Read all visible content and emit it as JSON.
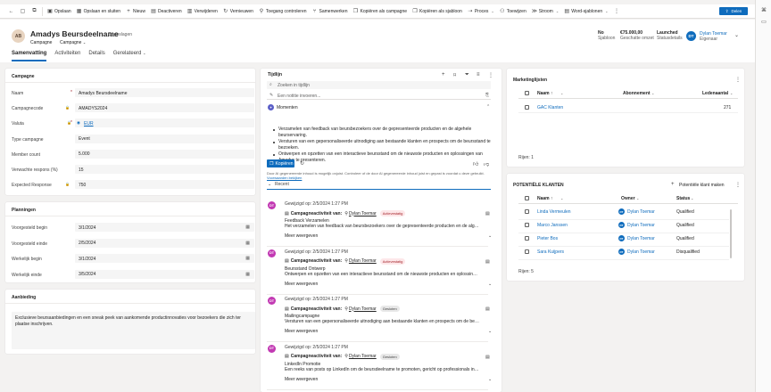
{
  "command_bar": {
    "nav": [
      {
        "name": "back-icon",
        "glyph": "←"
      },
      {
        "name": "page-icon",
        "glyph": "▢"
      },
      {
        "name": "popout-icon",
        "glyph": "⧉"
      }
    ],
    "commands": [
      {
        "name": "save-button",
        "icon": "save-icon",
        "glyph": "▣",
        "label": "Opslaan"
      },
      {
        "name": "save-close-button",
        "icon": "save-close-icon",
        "glyph": "▦",
        "label": "Opslaan en sluiten"
      },
      {
        "name": "new-button",
        "icon": "plus-icon",
        "glyph": "+",
        "label": "Nieuw"
      },
      {
        "name": "deactivate-button",
        "icon": "deactivate-icon",
        "glyph": "▤",
        "label": "Deactiveren"
      },
      {
        "name": "delete-button",
        "icon": "trash-icon",
        "glyph": "▥",
        "label": "Verwijderen"
      },
      {
        "name": "refresh-button",
        "icon": "refresh-icon",
        "glyph": "↻",
        "label": "Vernieuwen"
      },
      {
        "name": "check-access-button",
        "icon": "key-icon",
        "glyph": "⚲",
        "label": "Toegang controleren"
      },
      {
        "name": "merge-button",
        "icon": "merge-icon",
        "glyph": "⑂",
        "label": "Samenwerken"
      },
      {
        "name": "copy-as-campaign-button",
        "icon": "copy-icon",
        "glyph": "❐",
        "label": "Kopiëren als campagne"
      },
      {
        "name": "copy-as-template-button",
        "icon": "copy-template-icon",
        "glyph": "❐",
        "label": "Kopiëren als sjabloon"
      },
      {
        "name": "process-button",
        "icon": "process-icon",
        "glyph": "⇢",
        "label": "Proces",
        "chevron": true
      },
      {
        "name": "assign-button",
        "icon": "assign-icon",
        "glyph": "⚇",
        "label": "Toewijzen"
      },
      {
        "name": "flow-button",
        "icon": "flow-icon",
        "glyph": "≫",
        "label": "Stroom",
        "chevron": true
      },
      {
        "name": "word-templates-button",
        "icon": "word-icon",
        "glyph": "▤",
        "label": "Word-sjablonen",
        "chevron": true
      }
    ],
    "more_glyph": "⋮",
    "share_label": "Delen"
  },
  "header": {
    "initials": "AB",
    "title": "Amadys Beursdeelname",
    "saved": "- Opgeslagen",
    "entity": "Campagne",
    "form": "Campagne",
    "fields": [
      {
        "value": "No",
        "label": "Sjabloon"
      },
      {
        "value": "€75.000,00",
        "label": "Geschatte omzet"
      },
      {
        "value": "Launched",
        "label": "Statusdetails"
      }
    ],
    "owner_initials": "DT",
    "owner_name": "Dylan Toemar",
    "owner_label": "Eigenaar"
  },
  "tabs": [
    "Samenvatting",
    "Activiteiten",
    "Details",
    "Gerelateerd"
  ],
  "campaign": {
    "title": "Campagne",
    "fields": [
      {
        "label": "Naam",
        "value": "Amadys Beursdeelname",
        "req": "*"
      },
      {
        "label": "Campagnecode",
        "value": "AMADYS2024",
        "lock": "🔒"
      },
      {
        "label": "Valuta",
        "value": "EUR",
        "req": "*",
        "lock": "🔒",
        "link": true
      },
      {
        "label": "Type campagne",
        "value": "Event"
      },
      {
        "label": "Member count",
        "value": "5.000"
      },
      {
        "label": "Verwachte respons (%)",
        "value": "15"
      },
      {
        "label": "Expected Response",
        "value": "750",
        "lock": "🔒"
      }
    ]
  },
  "planning": {
    "title": "Planningen",
    "fields": [
      {
        "label": "Voorgesteld begin",
        "value": "3/1/2024"
      },
      {
        "label": "Voorgesteld einde",
        "value": "2/5/2024"
      },
      {
        "label": "Werkelijk begin",
        "value": "3/1/2024"
      },
      {
        "label": "Werkelijk einde",
        "value": "3/5/2024"
      }
    ]
  },
  "offer": {
    "title": "Aanbieding",
    "text": "Exclusieve beursaanbiedingen en een sneak peek van aankomende productinnovaties voor bezoekers die zich ter plaatse inschrijven."
  },
  "timeline": {
    "title": "Tijdlijn",
    "search_placeholder": "Zoeken in tijdlijn",
    "note_placeholder": "Een notitie invoeren...",
    "moments_label": "Momenten",
    "bullets": [
      "Verzamelen van feedback van beursbezoekers over de gepresenteerde producten en de algehele beurservaring.",
      "Versturen van een gepersonaliseerde uitnodiging aan bestaande klanten en prospects om de beursstand te bezoeken.",
      "Ontwerpen en opzetten van een interactieve beursstand om de nieuwste producten en oplossingen van Amadys te presenteren."
    ],
    "copy_label": "Kopiëren",
    "disclaimer": "Door AI gegenereerde inhoud is mogelijk onjuist. Controleer of de door AI gegenereerde inhoud juist en gepast is voordat u deze gebruikt.",
    "disclaimer_link": "Voorwaarden bekijken",
    "recent_label": "Recent",
    "activities": [
      {
        "initials": "DT",
        "date": "Gewijzigd op: 2/5/2024 1:27 PM",
        "type": "Campagneactiviteit van:",
        "owner": "Dylan Toemar",
        "status": "Actievestatig",
        "status_kind": "active",
        "subject": "Feedback Verzamelen",
        "desc": "Het verzamelen van feedback van beursbezoekers over de gepresenteerde producten en de algehele ...",
        "more": "Meer weergeven"
      },
      {
        "initials": "DT",
        "date": "Gewijzigd op: 2/5/2024 1:27 PM",
        "type": "Campagneactiviteit van:",
        "owner": "Dylan Toemar",
        "status": "Actievestatig",
        "status_kind": "active",
        "subject": "Beursstand Ontwerp",
        "desc": "Ontwerpen en opzetten van een interactieve beursstand om de nieuwste producten en oplossingen v...",
        "more": "Meer weergeven"
      },
      {
        "initials": "DT",
        "date": "Gewijzigd op: 2/5/2024 1:27 PM",
        "type": "Campagneactiviteit van:",
        "owner": "Dylan Toemar",
        "status": "Gesloten",
        "status_kind": "closed",
        "subject": "Mailingcampagne",
        "desc": "Versturen van een gepersonaliseerde uitnodiging aan bestaande klanten en prospects om de beurs...",
        "more": "Meer weergeven"
      },
      {
        "initials": "DT",
        "date": "Gewijzigd op: 2/5/2024 1:27 PM",
        "type": "Campagneactiviteit van:",
        "owner": "Dylan Toemar",
        "status": "Gesloten",
        "status_kind": "closed",
        "subject": "LinkedIn Promotie",
        "desc": "Een reeks van posts op LinkedIn om de beursdeelname te promoten, gericht op professionals in de in...",
        "more": "Meer weergeven"
      }
    ]
  },
  "marketing_lists": {
    "title": "Marketinglijsten",
    "columns": [
      "Naam ↑",
      "Abonnement",
      "Ledenaantal"
    ],
    "rows": [
      {
        "name": "GAC Klanten",
        "sub": "",
        "count": "271"
      }
    ],
    "count_label": "Rijen: 1"
  },
  "leads": {
    "title": "POTENTIËLE KLANTEN",
    "new_label": "Potentiële klant maken",
    "columns": [
      "Naam ↑",
      "Owner",
      "Status"
    ],
    "rows": [
      {
        "name": "Linda Vermeulen",
        "owner": "Dylan Toemar",
        "status": "Qualified"
      },
      {
        "name": "Marco Janssen",
        "owner": "Dylan Toemar",
        "status": "Qualified"
      },
      {
        "name": "Pieter Bos",
        "owner": "Dylan Toemar",
        "status": "Qualified"
      },
      {
        "name": "Sara Kuijpers",
        "owner": "Dylan Toemar",
        "status": "Disqualified"
      }
    ],
    "count_label": "Rijen: 5"
  }
}
